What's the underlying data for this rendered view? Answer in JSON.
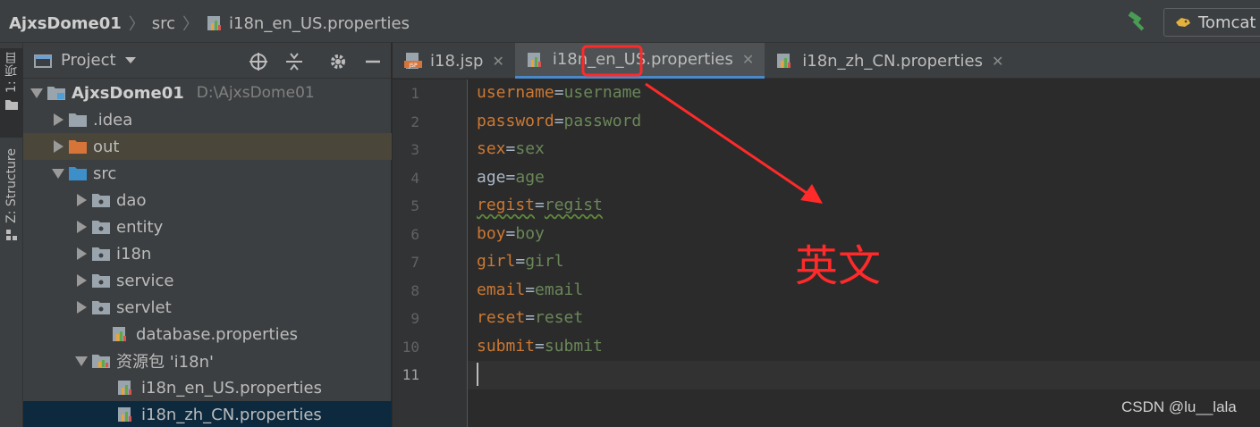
{
  "breadcrumb": {
    "project": "AjxsDome01",
    "folder": "src",
    "file": "i18n_en_US.properties"
  },
  "toolbar": {
    "run_config": "Tomcat",
    "build_icon": "hammer-icon",
    "run_config_icon": "tomcat-icon"
  },
  "stripe": {
    "project_tab": "1: 项目",
    "structure_tab": "Z: Structure"
  },
  "project_panel": {
    "title": "Project",
    "root": {
      "name": "AjxsDome01",
      "path": "D:\\AjxsDome01"
    },
    "items": [
      {
        "label": ".idea"
      },
      {
        "label": "out"
      },
      {
        "label": "src"
      },
      {
        "label": "dao"
      },
      {
        "label": "entity"
      },
      {
        "label": "i18n"
      },
      {
        "label": "service"
      },
      {
        "label": "servlet"
      },
      {
        "label": "database.properties"
      },
      {
        "label": "资源包 'i18n'"
      },
      {
        "label": "i18n_en_US.properties"
      },
      {
        "label": "i18n_zh_CN.properties"
      }
    ]
  },
  "tabs": [
    {
      "label": "i18.jsp"
    },
    {
      "label": "i18n_en_US.properties"
    },
    {
      "label": "i18n_zh_CN.properties"
    }
  ],
  "editor": {
    "lines": [
      {
        "num": "1",
        "key": "username",
        "value": "username"
      },
      {
        "num": "2",
        "key": "password",
        "value": "password"
      },
      {
        "num": "3",
        "key": "sex",
        "value": "sex"
      },
      {
        "num": "4",
        "key": "age",
        "value": "age"
      },
      {
        "num": "5",
        "key": "regist",
        "value": "regist"
      },
      {
        "num": "6",
        "key": "boy",
        "value": "boy"
      },
      {
        "num": "7",
        "key": "girl",
        "value": "girl"
      },
      {
        "num": "8",
        "key": "email",
        "value": "email"
      },
      {
        "num": "9",
        "key": "reset",
        "value": "reset"
      },
      {
        "num": "10",
        "key": "submit",
        "value": "submit"
      },
      {
        "num": "11"
      }
    ]
  },
  "annotation": {
    "text": "英文",
    "color": "#ff2a2a"
  },
  "watermark": "CSDN @lu__lala"
}
